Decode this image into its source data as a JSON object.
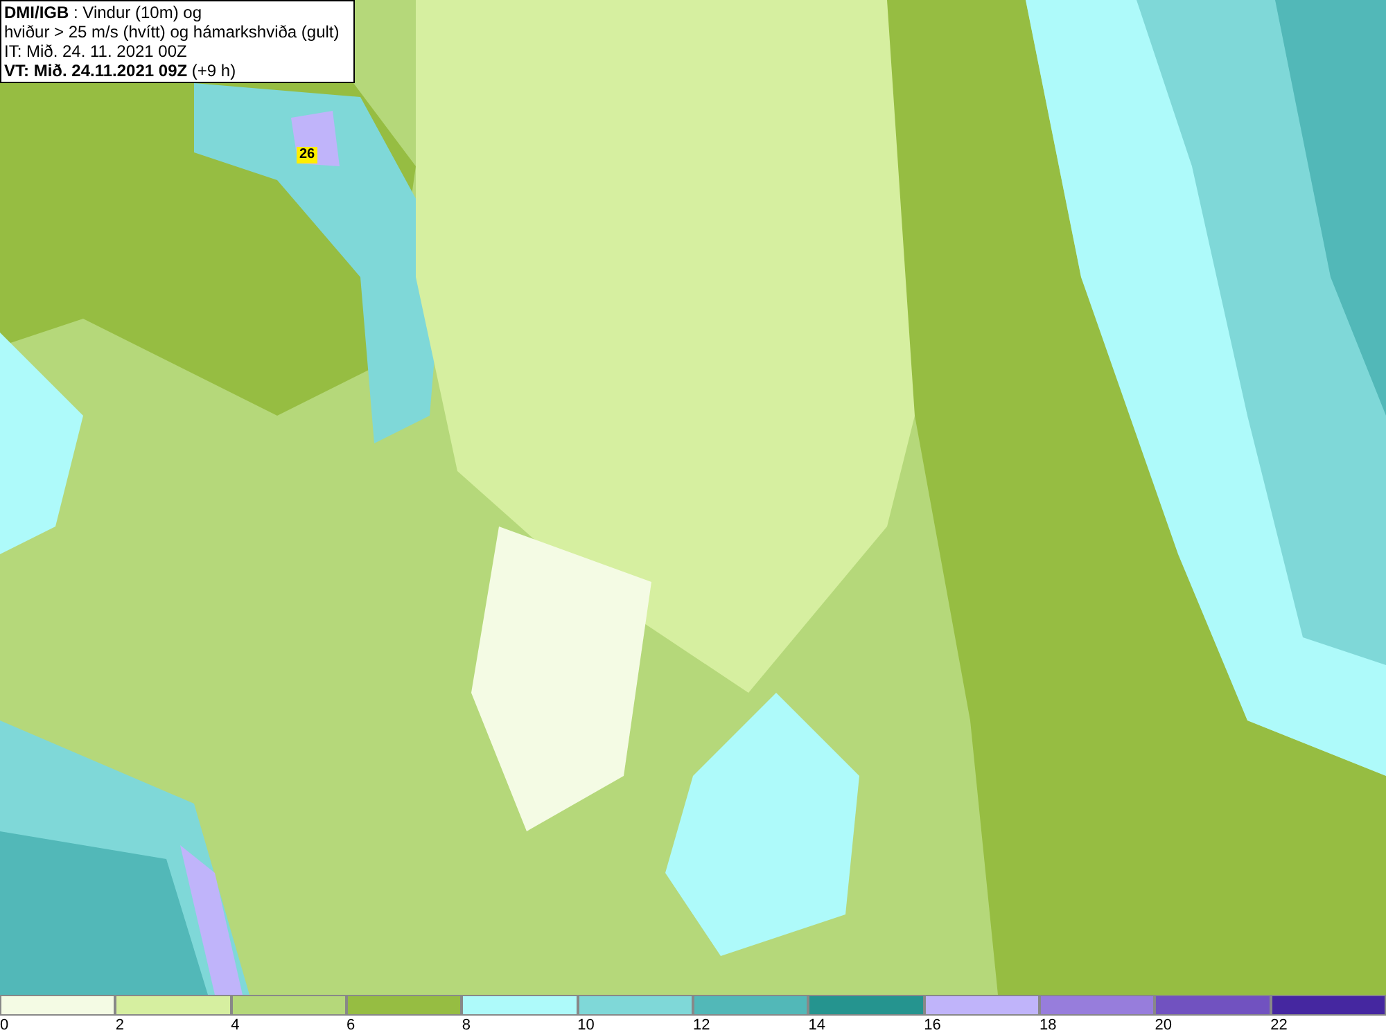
{
  "title": {
    "lines": [
      "**DMI/IGB** : Vindur (10m) og",
      "hviður > 25 m/s (hvítt) og hámarkshviða (gult)",
      "IT: Mið. 24. 11. 2021 00Z",
      "**VT: Mið. 24.11.2021 09Z** (+9 h)"
    ]
  },
  "map": {
    "gust_label": "26"
  },
  "legend": [
    {
      "label": "0",
      "color": "#f4fbe4"
    },
    {
      "label": "2",
      "color": "#d6efa0"
    },
    {
      "label": "4",
      "color": "#b5d87a"
    },
    {
      "label": "6",
      "color": "#96bd42"
    },
    {
      "label": "8",
      "color": "#aefafa"
    },
    {
      "label": "10",
      "color": "#7fd8d8"
    },
    {
      "label": "12",
      "color": "#52b8b8"
    },
    {
      "label": "14",
      "color": "#25948f"
    },
    {
      "label": "16",
      "color": "#c0b4fa"
    },
    {
      "label": "18",
      "color": "#977ddc"
    },
    {
      "label": "20",
      "color": "#7152c0"
    },
    {
      "label": "22",
      "color": "#4527a0"
    }
  ]
}
